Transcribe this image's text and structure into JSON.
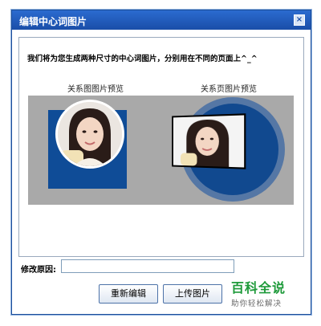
{
  "dialog": {
    "title": "编辑中心词图片",
    "close_label": "×",
    "description": "我们将为您生成两种尺寸的中心词图片，分别用在不同的页面上^_^",
    "preview_labels": {
      "relation_graph": "关系图图片预览",
      "relation_page": "关系页图片预览"
    },
    "reason": {
      "label": "修改原因:",
      "value": "",
      "placeholder": ""
    },
    "buttons": {
      "reedit": "重新编辑",
      "upload": "上传图片"
    }
  },
  "watermark": {
    "title": "百科全说",
    "subtitle": "助你轻松解决"
  },
  "colors": {
    "titlebar": "#1a4ea8",
    "preview_background": "#a9a9a9",
    "preview_blue": "#0f4c97",
    "watermark_green": "#1e9a3a"
  }
}
